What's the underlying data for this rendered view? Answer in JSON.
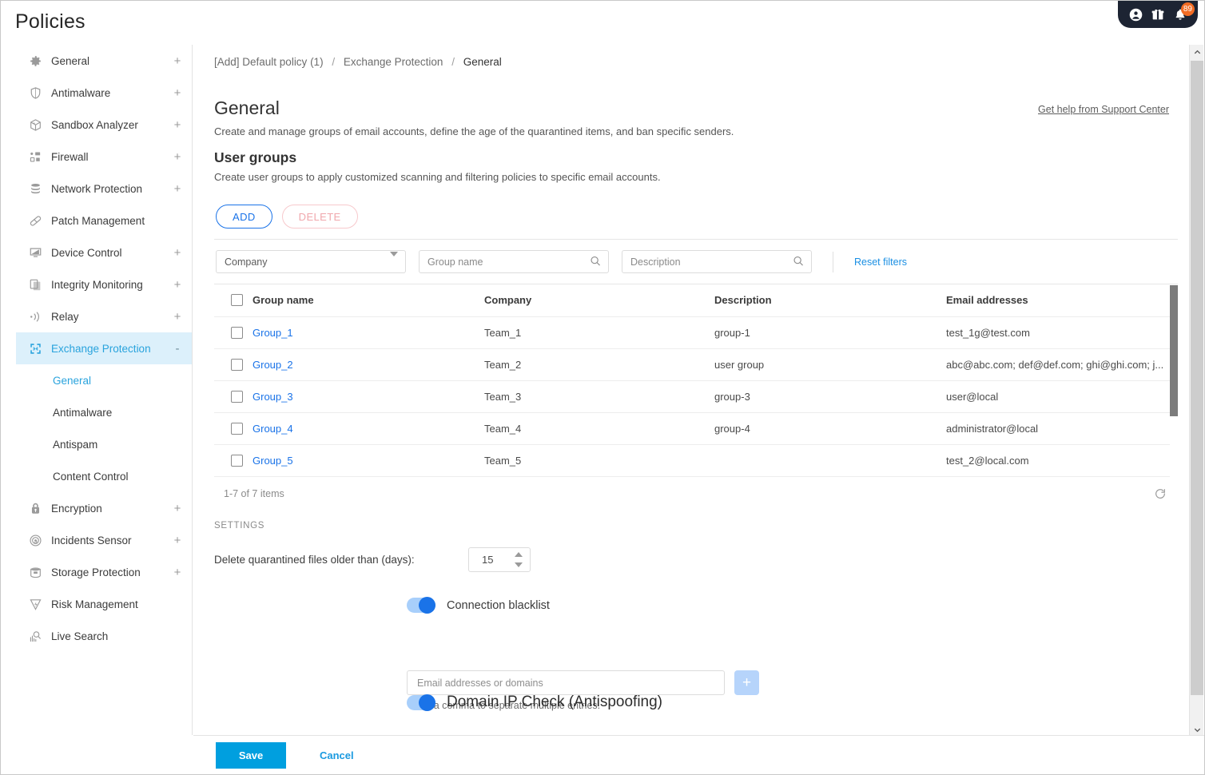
{
  "page": {
    "title": "Policies"
  },
  "topbar": {
    "icons": [
      {
        "name": "account-icon"
      },
      {
        "name": "gift-icon"
      },
      {
        "name": "notifications-icon",
        "badge": "89"
      }
    ]
  },
  "sidebar": {
    "items": [
      {
        "label": "General",
        "icon": "gear-icon",
        "expander": "+"
      },
      {
        "label": "Antimalware",
        "icon": "shield-icon",
        "expander": "+"
      },
      {
        "label": "Sandbox Analyzer",
        "icon": "cube-icon",
        "expander": "+"
      },
      {
        "label": "Firewall",
        "icon": "firewall-icon",
        "expander": "+"
      },
      {
        "label": "Network Protection",
        "icon": "stack-icon",
        "expander": "+"
      },
      {
        "label": "Patch Management",
        "icon": "bandage-icon",
        "expander": ""
      },
      {
        "label": "Device Control",
        "icon": "monitor-icon",
        "expander": "+"
      },
      {
        "label": "Integrity Monitoring",
        "icon": "copy-icon",
        "expander": "+"
      },
      {
        "label": "Relay",
        "icon": "broadcast-icon",
        "expander": "+"
      },
      {
        "label": "Exchange Protection",
        "icon": "exchange-icon",
        "expander": "-",
        "active": true
      },
      {
        "label": "Encryption",
        "icon": "lock-icon",
        "expander": "+"
      },
      {
        "label": "Incidents Sensor",
        "icon": "sensor-icon",
        "expander": "+"
      },
      {
        "label": "Storage Protection",
        "icon": "storage-icon",
        "expander": "+"
      },
      {
        "label": "Risk Management",
        "icon": "risk-icon",
        "expander": ""
      },
      {
        "label": "Live Search",
        "icon": "live-search-icon",
        "expander": ""
      }
    ],
    "subitems": [
      {
        "label": "General",
        "selected": true
      },
      {
        "label": "Antimalware",
        "selected": false
      },
      {
        "label": "Antispam",
        "selected": false
      },
      {
        "label": "Content Control",
        "selected": false
      }
    ]
  },
  "breadcrumb": {
    "first": "[Add] Default policy (1)",
    "second": "Exchange Protection",
    "current": "General",
    "separator": "/"
  },
  "main": {
    "help_link": "Get help from Support Center",
    "heading": "General",
    "description": "Create and manage groups of email accounts, define the age of the quarantined items, and ban specific senders.",
    "subheading": "User groups",
    "sub_description": "Create user groups to apply customized scanning and filtering policies to specific email accounts."
  },
  "toolbar": {
    "add_label": "ADD",
    "delete_label": "DELETE"
  },
  "filters": {
    "company_selected": "Company",
    "group_name_placeholder": "Group name",
    "description_placeholder": "Description",
    "reset_label": "Reset filters"
  },
  "table": {
    "columns": [
      "Group name",
      "Company",
      "Description",
      "Email addresses"
    ],
    "rows": [
      {
        "name": "Group_1",
        "company": "Team_1",
        "description": "group-1",
        "emails": "test_1g@test.com"
      },
      {
        "name": "Group_2",
        "company": "Team_2",
        "description": "user group",
        "emails": "abc@abc.com; def@def.com; ghi@ghi.com; j..."
      },
      {
        "name": "Group_3",
        "company": "Team_3",
        "description": "group-3",
        "emails": "user@local"
      },
      {
        "name": "Group_4",
        "company": "Team_4",
        "description": "group-4",
        "emails": "administrator@local"
      },
      {
        "name": "Group_5",
        "company": "Team_5",
        "description": "",
        "emails": "test_2@local.com"
      }
    ],
    "items_count": "1-7 of 7 items"
  },
  "settings": {
    "label": "SETTINGS",
    "quarantine_label": "Delete quarantined files older than (days):",
    "quarantine_value": "15",
    "connection_blacklist_label": "Connection blacklist",
    "connection_blacklist_enabled": true,
    "blacklist_placeholder": "Email addresses or domains",
    "blacklist_value": "",
    "add_entry_label": "+",
    "hint": "Use a comma to separate multiple entries.",
    "domain_ip_check_label": "Domain IP Check (Antispoofing)",
    "domain_ip_check_enabled": true
  },
  "actions": {
    "save_label": "Save",
    "cancel_label": "Cancel"
  },
  "colors": {
    "accent": "#009fdf",
    "link": "#1a73e8",
    "active_bg": "#dcf0fb",
    "badge": "#f26c24",
    "topbar": "#1d2433"
  }
}
